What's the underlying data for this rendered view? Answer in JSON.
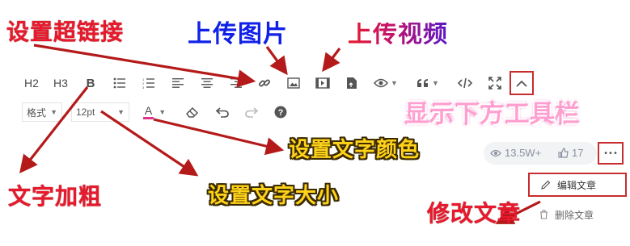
{
  "annotations": {
    "set_link": "设置超链接",
    "upload_image": "上传图片",
    "upload_video": "上传视频",
    "show_toolbar": "显示下方工具栏",
    "text_color": "设置文字颜色",
    "bold": "文字加粗",
    "font_size": "设置文字大小",
    "edit_article": "修改文章"
  },
  "toolbar": {
    "h2": "H2",
    "h3": "H3",
    "bold": "B",
    "format_label": "格式",
    "size_value": "12pt",
    "font_color_label": "A"
  },
  "stats": {
    "views": "13.5W+",
    "likes": "17"
  },
  "menu": {
    "more": "•••",
    "edit": "编辑文章",
    "delete": "删除文章"
  },
  "colors": {
    "arrow": "#b51a1a",
    "highlight_box": "#cc2b2b",
    "font_color_underline": "#e0338b"
  }
}
